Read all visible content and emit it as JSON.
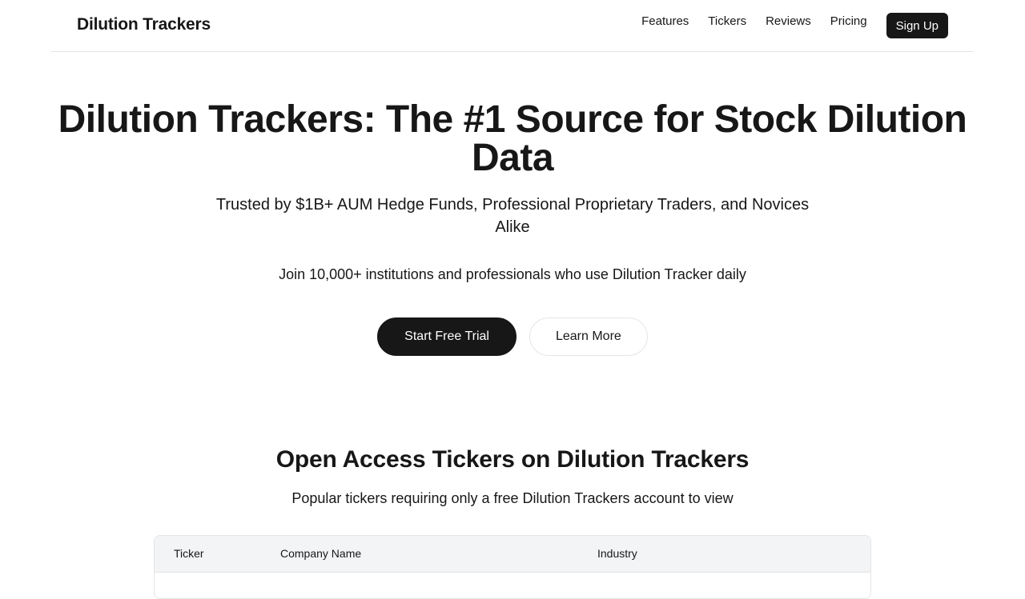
{
  "nav": {
    "brand": "Dilution Trackers",
    "links": [
      "Features",
      "Tickers",
      "Reviews",
      "Pricing"
    ],
    "signup_label": "Sign Up"
  },
  "hero": {
    "title": "Dilution Trackers: The #1 Source for Stock Dilution Data",
    "subtitle": "Trusted by $1B+ AUM Hedge Funds, Professional Proprietary Traders, and Novices Alike",
    "join_text": "Join 10,000+ institutions and professionals who use Dilution Tracker daily",
    "primary_cta": "Start Free Trial",
    "secondary_cta": "Learn More"
  },
  "tickers_section": {
    "title": "Open Access Tickers on Dilution Trackers",
    "subtitle": "Popular tickers requiring only a free Dilution Trackers account to view",
    "columns": [
      "Ticker",
      "Company Name",
      "Industry"
    ]
  },
  "colors": {
    "primary": "#171717",
    "background": "#ffffff",
    "table_header_bg": "#f3f4f6",
    "border": "#e5e5e5"
  }
}
